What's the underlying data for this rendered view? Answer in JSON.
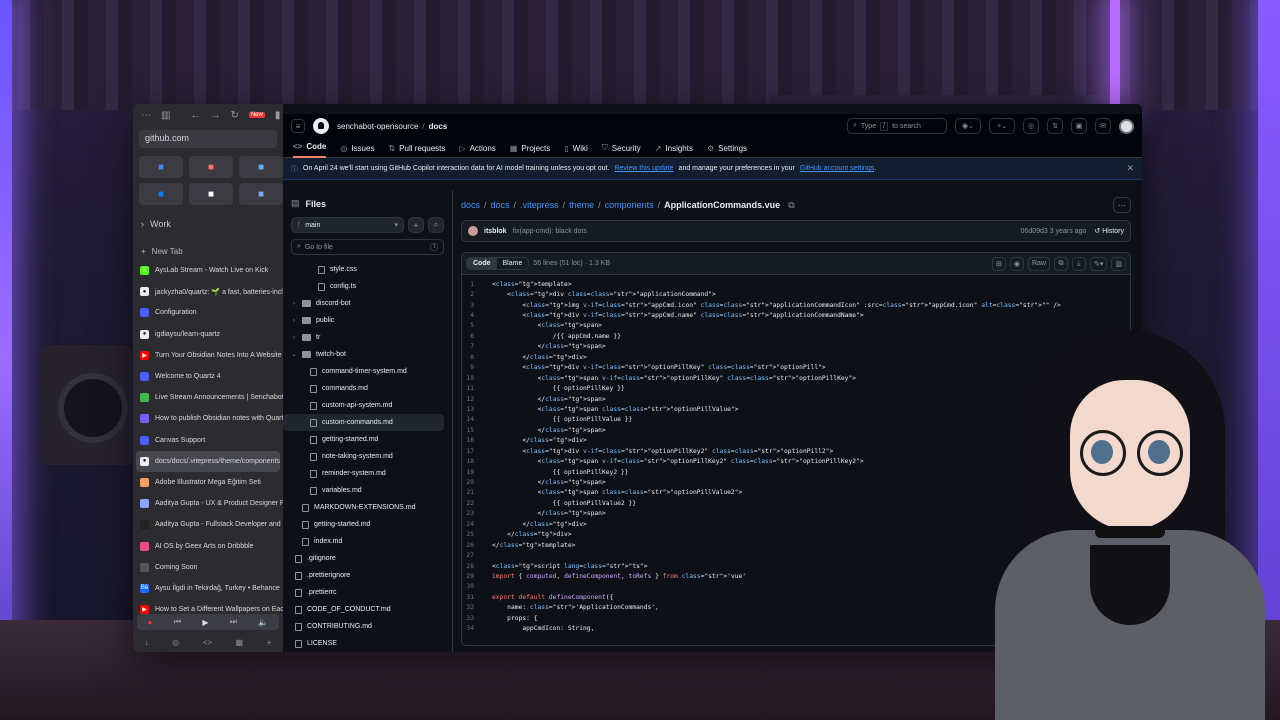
{
  "sidebar": {
    "url": "github.com",
    "new_badge": "New",
    "work_label": "Work",
    "new_tab_label": "New Tab",
    "favorites": [
      {
        "icon": "chrome-icon",
        "color": "#4285f4"
      },
      {
        "icon": "figma-icon",
        "color": "#ff7262"
      },
      {
        "icon": "finder-icon",
        "color": "#58b0f5"
      },
      {
        "icon": "meta-icon",
        "color": "#0a7cff"
      },
      {
        "icon": "notion-icon",
        "color": "#ffffff"
      },
      {
        "icon": "gemini-icon",
        "color": "#7aa7ff"
      }
    ],
    "tabs": [
      {
        "title": "AysLab Stream - Watch Live on Kick",
        "color": "#53fc18",
        "glyph": "K"
      },
      {
        "title": "jackyzha0/quartz: 🌱 a fast, batteries-incl",
        "color": "#e6edf3",
        "glyph": "●"
      },
      {
        "title": "Configuration",
        "color": "#4c5cff",
        "glyph": ""
      },
      {
        "title": "igdiaysu/learn-quartz",
        "color": "#e6edf3",
        "glyph": "●"
      },
      {
        "title": "Turn Your Obsidian Notes Into A Website -",
        "color": "#ff0000",
        "glyph": "▶"
      },
      {
        "title": "Welcome to Quartz 4",
        "color": "#4c5cff",
        "glyph": ""
      },
      {
        "title": "Live Stream Announcements | Senchabot",
        "color": "#3fb950",
        "glyph": ""
      },
      {
        "title": "How to publish Obsidian notes with Quart",
        "color": "#7b5cff",
        "glyph": ""
      },
      {
        "title": "Canvas Support",
        "color": "#4c5cff",
        "glyph": ""
      },
      {
        "title": "docs/docs/.vitepress/theme/components/",
        "color": "#e6edf3",
        "glyph": "●",
        "active": true
      },
      {
        "title": "Adobe Illustrator Mega Eğitim Seti",
        "color": "#f4a261",
        "glyph": ""
      },
      {
        "title": "Aaditya Gupta - UX & Product Designer Po",
        "color": "#8aa4ff",
        "glyph": ""
      },
      {
        "title": "Aaditya Gupta - Fullstack Developer and D",
        "color": "#222222",
        "glyph": ""
      },
      {
        "title": "AI OS by Geex Arts on Dribbble",
        "color": "#ea4c89",
        "glyph": ""
      },
      {
        "title": "Coming Soon",
        "color": "#555555",
        "glyph": ""
      },
      {
        "title": "Aysu İlgdi in Tekirdağ, Turkey • Behance",
        "color": "#1769ff",
        "glyph": "Bē"
      },
      {
        "title": "How to Set a Different Wallpapers on Each",
        "color": "#ff0000",
        "glyph": "▶"
      }
    ]
  },
  "header": {
    "owner": "senchabot-opensource",
    "repo": "docs",
    "search_prefix": "Type",
    "search_key": "/",
    "search_suffix": "to search"
  },
  "nav": [
    {
      "label": "Code",
      "icon": "code-icon",
      "glyph": "<>",
      "active": true
    },
    {
      "label": "Issues",
      "icon": "issues-icon",
      "glyph": "◎"
    },
    {
      "label": "Pull requests",
      "icon": "pull-request-icon",
      "glyph": "⇅"
    },
    {
      "label": "Actions",
      "icon": "actions-icon",
      "glyph": "▷"
    },
    {
      "label": "Projects",
      "icon": "projects-icon",
      "glyph": "▦"
    },
    {
      "label": "Wiki",
      "icon": "wiki-icon",
      "glyph": "▯"
    },
    {
      "label": "Security",
      "icon": "security-icon",
      "glyph": "⛉"
    },
    {
      "label": "Insights",
      "icon": "insights-icon",
      "glyph": "↗"
    },
    {
      "label": "Settings",
      "icon": "settings-icon",
      "glyph": "⚙"
    }
  ],
  "banner": {
    "text_before": "On April 24 we'll start using GitHub Copilot interaction data for AI model training unless you opt out.",
    "link1": "Review this update",
    "text_middle": "and manage your preferences in your",
    "link2": "GitHub account settings",
    "text_end": "."
  },
  "files": {
    "title": "Files",
    "branch": "main",
    "goto_placeholder": "Go to file",
    "goto_key": "t",
    "tree": [
      {
        "name": "style.css",
        "kind": "file",
        "depth": 2
      },
      {
        "name": "config.ts",
        "kind": "file",
        "depth": 2
      },
      {
        "name": "discord-bot",
        "kind": "folder",
        "depth": 0,
        "chev": "›"
      },
      {
        "name": "public",
        "kind": "folder",
        "depth": 0,
        "chev": "›"
      },
      {
        "name": "tr",
        "kind": "folder",
        "depth": 0,
        "chev": "›"
      },
      {
        "name": "twitch-bot",
        "kind": "folder",
        "depth": 0,
        "chev": "⌄"
      },
      {
        "name": "command-timer-system.md",
        "kind": "file",
        "depth": 1
      },
      {
        "name": "commands.md",
        "kind": "file",
        "depth": 1
      },
      {
        "name": "custom-api-system.md",
        "kind": "file",
        "depth": 1
      },
      {
        "name": "custom-commands.md",
        "kind": "file",
        "depth": 1,
        "selected": true
      },
      {
        "name": "getting-started.md",
        "kind": "file",
        "depth": 1
      },
      {
        "name": "note-taking-system.md",
        "kind": "file",
        "depth": 1
      },
      {
        "name": "reminder-system.md",
        "kind": "file",
        "depth": 1
      },
      {
        "name": "variables.md",
        "kind": "file",
        "depth": 1
      },
      {
        "name": "MARKDOWN-EXTENSIONS.md",
        "kind": "file",
        "depth": 0
      },
      {
        "name": "getting-started.md",
        "kind": "file",
        "depth": 0
      },
      {
        "name": "index.md",
        "kind": "file",
        "depth": 0
      },
      {
        "name": ".gitignore",
        "kind": "file",
        "depth": -1
      },
      {
        "name": ".prettierignore",
        "kind": "file",
        "depth": -1
      },
      {
        "name": ".prettierrc",
        "kind": "file",
        "depth": -1
      },
      {
        "name": "CODE_OF_CONDUCT.md",
        "kind": "file",
        "depth": -1
      },
      {
        "name": "CONTRIBUTING.md",
        "kind": "file",
        "depth": -1
      },
      {
        "name": "LICENSE",
        "kind": "file",
        "depth": -1
      }
    ]
  },
  "path": {
    "segments": [
      "docs",
      "docs",
      ".vitepress",
      "theme",
      "components"
    ],
    "file": "ApplicationCommands.vue"
  },
  "commit": {
    "author": "itsblok",
    "message": "fix(app-cmd): black dots",
    "sha": "06d09d3",
    "age": "3 years ago",
    "history_label": "History"
  },
  "code": {
    "tab_code": "Code",
    "tab_blame": "Blame",
    "stats": "56 lines (51 loc) · 1.3 KB",
    "raw_label": "Raw",
    "lines": [
      "<template>",
      "    <div class=\"applicationCommand\">",
      "        <img v-if=\"appCmd.icon\" class=\"applicationCommandIcon\" :src=\"appCmd.icon\" alt=\"\" />",
      "        <div v-if=\"appCmd.name\" class=\"applicationCommandName\">",
      "            <span>",
      "                /{{ appCmd.name }}",
      "            </span>",
      "        </div>",
      "        <div v-if=\"optionPillKey\" class=\"optionPill\">",
      "            <span v-if=\"optionPillKey\" class=\"optionPillKey\">",
      "                {{ optionPillKey }}",
      "            </span>",
      "            <span class=\"optionPillValue\">",
      "                {{ optionPillValue }}",
      "            </span>",
      "        </div>",
      "        <div v-if=\"optionPillKey2\" class=\"optionPill2\">",
      "            <span v-if=\"optionPillKey2\" class=\"optionPillKey2\">",
      "                {{ optionPillKey2 }}",
      "            </span>",
      "            <span class=\"optionPillValue2\">",
      "                {{ optionPillValue2 }}",
      "            </span>",
      "        </div>",
      "    </div>",
      "</template>",
      "",
      "<script lang=\"ts\">",
      "import { computed, defineComponent, toRefs } from 'vue'",
      "",
      "export default defineComponent({",
      "    name: 'ApplicationCommands',",
      "    props: {",
      "        appCmdIcon: String,"
    ]
  }
}
